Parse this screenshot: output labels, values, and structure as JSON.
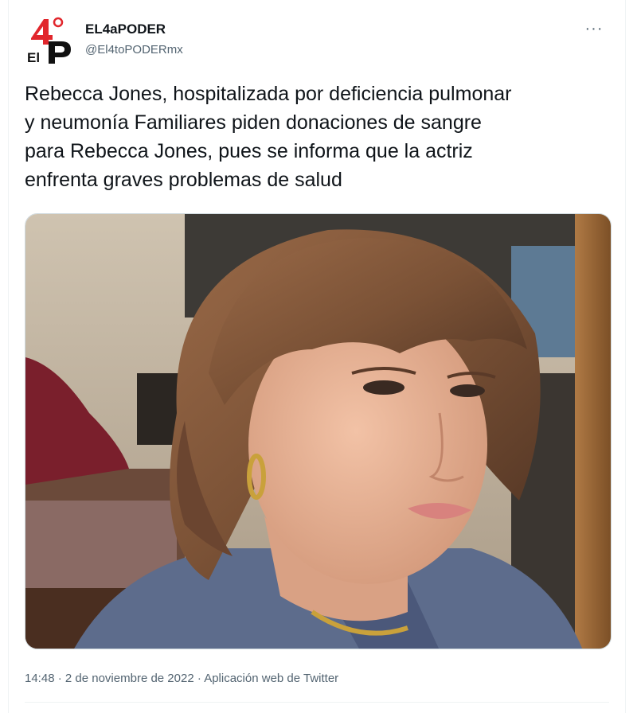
{
  "author": {
    "display_name": "EL4aPODER",
    "handle": "@El4toPODERmx",
    "avatar_logo_text": "4P El"
  },
  "more_menu": {
    "label": "···"
  },
  "tweet": {
    "text": "Rebecca Jones, hospitalizada por deficiencia pulmonar\ny neumonía Familiares piden donaciones de sangre\npara Rebecca Jones, pues se informa que la actriz\nenfrenta graves problemas de salud"
  },
  "meta": {
    "time": "14:48",
    "separator": "·",
    "date": "2 de noviembre de 2022",
    "source": "Aplicación web de Twitter"
  },
  "colors": {
    "brand_red": "#e1262c",
    "text_primary": "#0f1419",
    "text_secondary": "#536471"
  }
}
